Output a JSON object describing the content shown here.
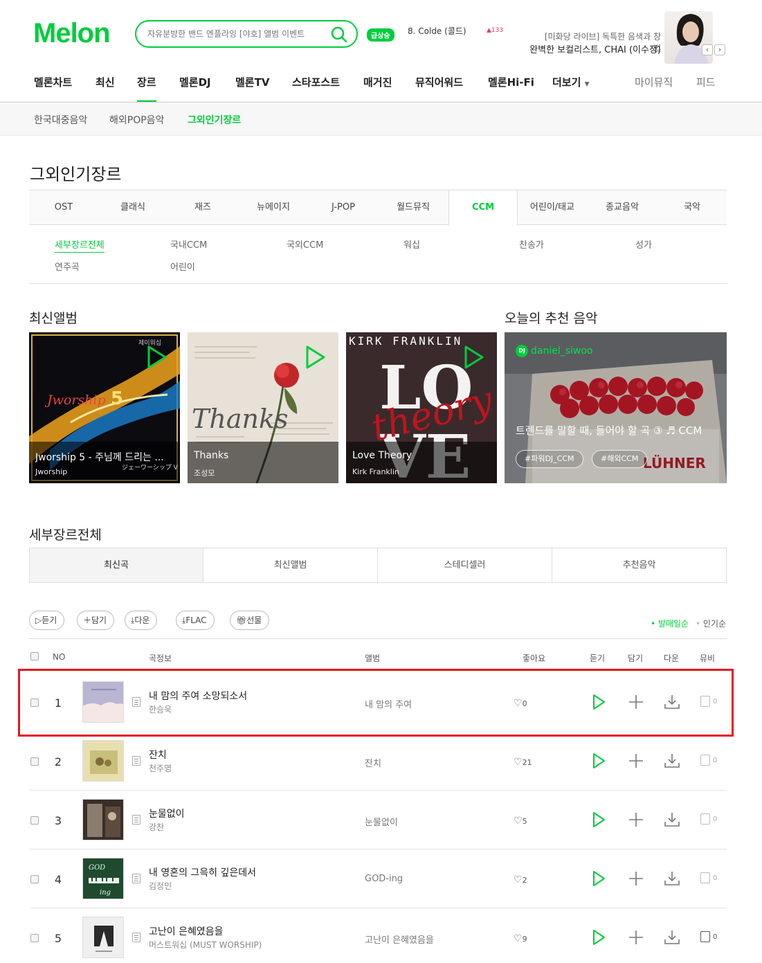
{
  "header": {
    "logo": "Melon",
    "search_placeholder": "자유분방한 밴드 엔플라잉 [야호] 앨범 이벤트",
    "rising_badge": "급상승",
    "rising_text": "8. Colde (콜드)",
    "rising_count": "133",
    "promo_sub": "[미화당 라이브] 독특한 음색과 창법",
    "promo_main": "완벽한 보컬리스트, CHAI (이수정)",
    "prev": "‹",
    "next": "›"
  },
  "gnb": [
    "멜론차트",
    "최신",
    "장르",
    "멜론DJ",
    "멜론TV",
    "스타포스트",
    "매거진",
    "뮤직어워드",
    "멜론Hi-Fi",
    "더보기",
    "마이뮤직",
    "피드"
  ],
  "subnav": [
    "한국대중음악",
    "해외POP음악",
    "그외인기장르"
  ],
  "page_title": "그외인기장르",
  "genre_tabs": [
    "OST",
    "클래식",
    "재즈",
    "뉴에이지",
    "J-POP",
    "월드뮤직",
    "CCM",
    "어린이/태교",
    "종교음악",
    "국악"
  ],
  "sub_genres": [
    "세부장르전체",
    "국내CCM",
    "국외CCM",
    "워십",
    "찬송가",
    "성가",
    "연주곡",
    "어린이"
  ],
  "latest_albums": {
    "title": "최신앨범",
    "items": [
      {
        "title": "Jworship 5 - 주님께 드리는 ...",
        "artist": "Jworship",
        "art_text": "Jworship",
        "art_num": "5",
        "art_corner": "제이워십",
        "art_jp": "ジェーワーシップ V"
      },
      {
        "title": "Thanks",
        "artist": "조성모",
        "art_text": "Thanks"
      },
      {
        "title": "Love Theory",
        "artist": "Kirk Franklin",
        "art_top": "KIRK FRANKLIN",
        "art_love1": "LO",
        "art_love2": "VE",
        "art_theory": "theory"
      }
    ]
  },
  "recommend": {
    "title": "오늘의 추천 음악",
    "dj_badge": "DJ",
    "dj": "daniel_siwoo",
    "text": "트렌드를 말할 때, 들어야 할 곡 ③ ♬ CCM",
    "tags": [
      "#파워DJ_CCM",
      "#해외CCM"
    ],
    "sign": "LÜHNER"
  },
  "section_title": "세부장르전체",
  "content_tabs": [
    "최신곡",
    "최신앨범",
    "스테디셀러",
    "추천음악"
  ],
  "actions": [
    "듣기",
    "담기",
    "다운",
    "FLAC",
    "선물"
  ],
  "sort": [
    "발매일순",
    "인기순"
  ],
  "table_headers": {
    "no": "NO",
    "song": "곡정보",
    "album": "앨범",
    "like": "좋아요",
    "play": "듣기",
    "add": "담기",
    "down": "다운",
    "mv": "뮤비"
  },
  "rows": [
    {
      "no": "1",
      "song": "내 맘의 주여 소망되소서",
      "artist": "한승욱",
      "album": "내 맘의 주여",
      "likes": "0",
      "mv": "0"
    },
    {
      "no": "2",
      "song": "잔치",
      "artist": "천주영",
      "album": "잔치",
      "likes": "21",
      "mv": "0"
    },
    {
      "no": "3",
      "song": "눈물없이",
      "artist": "강찬",
      "album": "눈물없이",
      "likes": "5",
      "mv": "0"
    },
    {
      "no": "4",
      "song": "내 영혼의 그윽히 깊은데서",
      "artist": "김정민",
      "album": "GOD-ing",
      "likes": "2",
      "mv": "0",
      "art_text": "GOD",
      "art_sub": "ing"
    },
    {
      "no": "5",
      "song": "고난이 은혜였음을",
      "artist": "머스트워십 (MUST WORSHIP)",
      "album": "고난이 은혜였음을",
      "likes": "9",
      "mv": "0"
    }
  ],
  "colors": {
    "accent": "#00cd3c",
    "highlight": "#e8151f"
  }
}
